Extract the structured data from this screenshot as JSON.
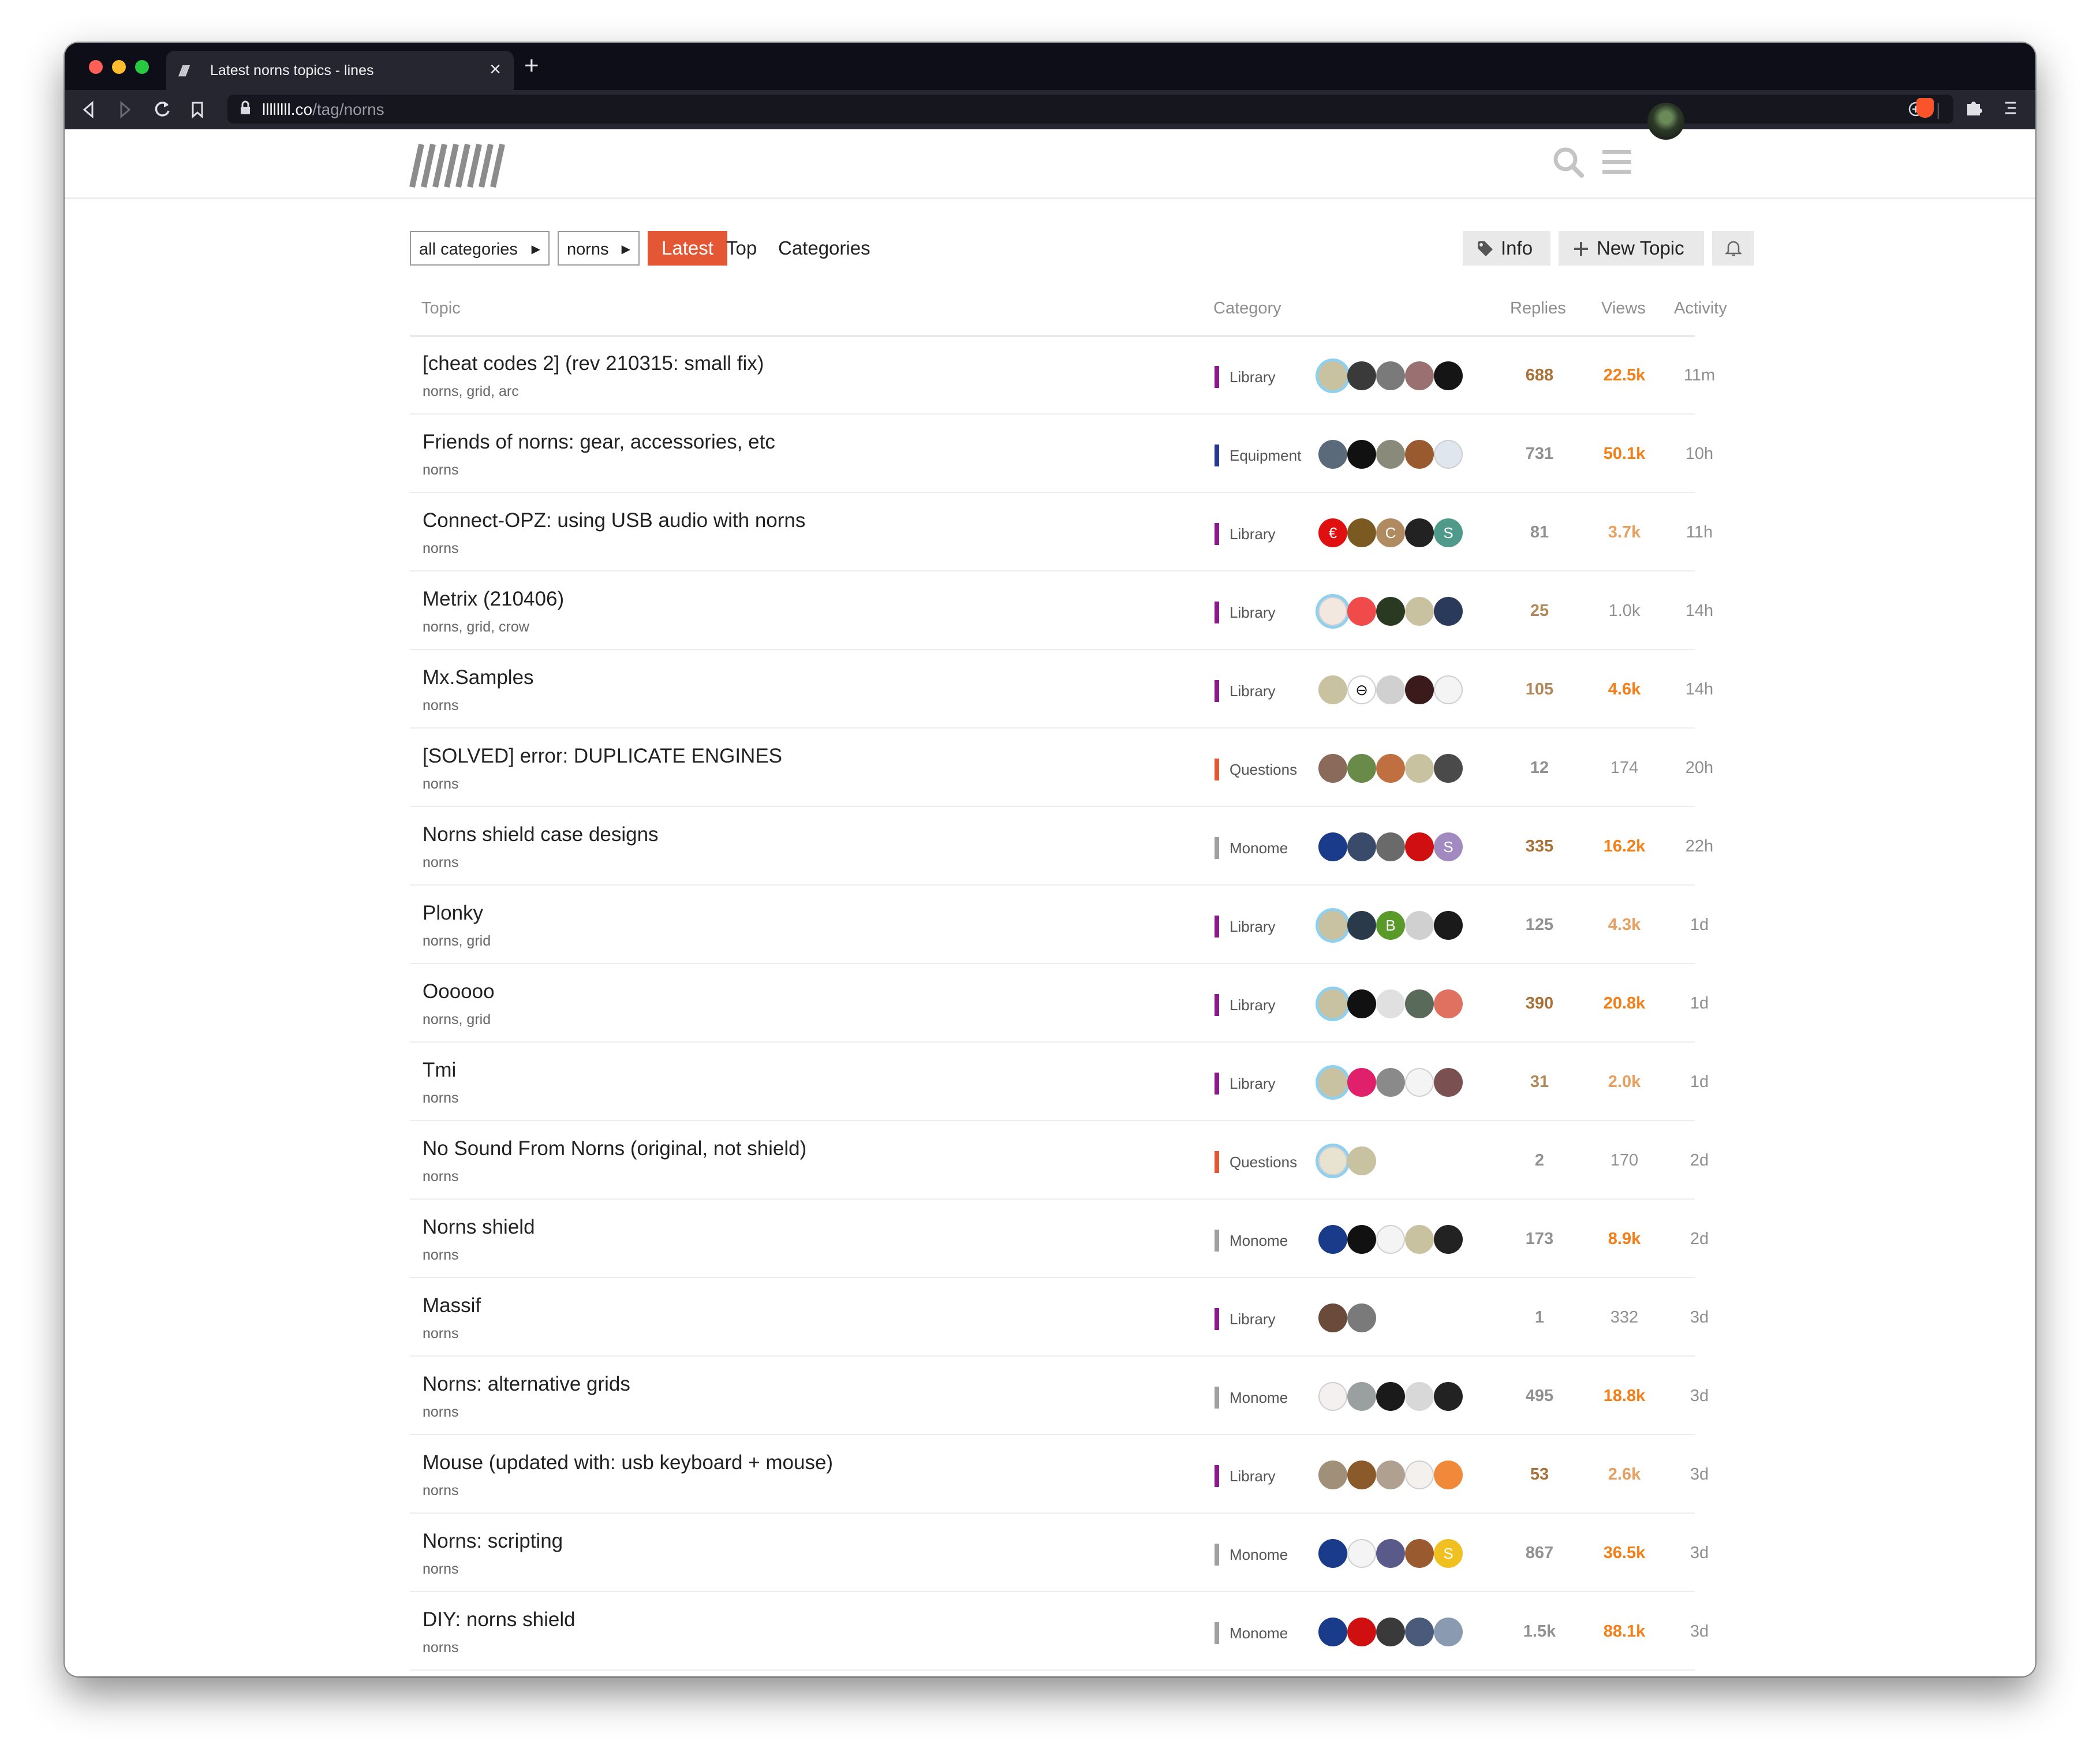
{
  "browser": {
    "tab_title": "Latest norns topics - lines",
    "tab_favicon": "////",
    "tab_close": "×",
    "new_tab": "+",
    "url_domain": "llllllll.co",
    "url_path": "/tag/norns",
    "icons": [
      "back-icon",
      "forward-icon",
      "reload-icon",
      "bookmark-icon",
      "lock-icon",
      "share-icon",
      "brave-shield-icon",
      "extensions-icon",
      "menu-icon"
    ]
  },
  "header": {
    "logo_alt": "llllllll",
    "icons": [
      "search-icon",
      "hamburger-menu-icon",
      "user-avatar"
    ]
  },
  "nav": {
    "category_filter": "all categories",
    "tag_filter": "norns",
    "tabs": [
      "Latest",
      "Top",
      "Categories"
    ],
    "active_tab": "Latest",
    "info_button": "Info",
    "new_topic_button": "New Topic",
    "bell": "notifications-bell-icon"
  },
  "columns": {
    "topic": "Topic",
    "category": "Category",
    "replies": "Replies",
    "views": "Views",
    "activity": "Activity"
  },
  "colors": {
    "accent": "#e45735",
    "Library": "#8c1a8c",
    "Equipment": "#283890",
    "Questions": "#e45735",
    "Monome": "#a0a0a0",
    "replies_hot": "#a87137",
    "views_hot": "#f57f17",
    "neutral": "#919191"
  },
  "topics": [
    {
      "title": "[cheat codes 2] (rev 210315: small fix)",
      "tags": "norns, grid, arc",
      "category": "Library",
      "replies": "688",
      "views": "22.5k",
      "activity": "11m",
      "replies_heat": 2,
      "views_heat": 2,
      "posters": [
        {
          "c": "#c8c2a0",
          "ring": true
        },
        {
          "c": "#3a3a3a"
        },
        {
          "c": "#7a7a7a"
        },
        {
          "c": "#9a7070"
        },
        {
          "c": "#151515"
        }
      ]
    },
    {
      "title": "Friends of norns: gear, accessories, etc",
      "tags": "norns",
      "category": "Equipment",
      "replies": "731",
      "views": "50.1k",
      "activity": "10h",
      "replies_heat": 0,
      "views_heat": 2,
      "posters": [
        {
          "c": "#5a6a7a"
        },
        {
          "c": "#111111"
        },
        {
          "c": "#8a8a7a"
        },
        {
          "c": "#9a5a30"
        },
        {
          "c": "#dfe6ee"
        }
      ]
    },
    {
      "title": "Connect-OPZ: using USB audio with norns",
      "tags": "norns",
      "category": "Library",
      "replies": "81",
      "views": "3.7k",
      "activity": "11h",
      "replies_heat": 0,
      "views_heat": 1,
      "posters": [
        {
          "c": "#e01010",
          "t": "€"
        },
        {
          "c": "#7a5a20"
        },
        {
          "c": "#b08a60",
          "t": "C"
        },
        {
          "c": "#222222"
        },
        {
          "c": "#4f9a8a",
          "t": "S"
        }
      ]
    },
    {
      "title": "Metrix (210406)",
      "tags": "norns, grid, crow",
      "category": "Library",
      "replies": "25",
      "views": "1.0k",
      "activity": "14h",
      "replies_heat": 1,
      "views_heat": 0,
      "posters": [
        {
          "c": "#f2e8e0",
          "ring": true
        },
        {
          "c": "#f04a4a"
        },
        {
          "c": "#2a3a22"
        },
        {
          "c": "#c8c2a0"
        },
        {
          "c": "#2a3a5a"
        }
      ]
    },
    {
      "title": "Mx.Samples",
      "tags": "norns",
      "category": "Library",
      "replies": "105",
      "views": "4.6k",
      "activity": "14h",
      "replies_heat": 1,
      "views_heat": 2,
      "posters": [
        {
          "c": "#c8c2a0"
        },
        {
          "c": "#ffffff",
          "t": "⊖"
        },
        {
          "c": "#d0d0d0"
        },
        {
          "c": "#3a1a1a"
        },
        {
          "c": "#f4f4f4"
        }
      ]
    },
    {
      "title": "[SOLVED] error: DUPLICATE ENGINES",
      "tags": "norns",
      "category": "Questions",
      "replies": "12",
      "views": "174",
      "activity": "20h",
      "replies_heat": 0,
      "views_heat": 0,
      "posters": [
        {
          "c": "#8a6a5a"
        },
        {
          "c": "#6a8a4a"
        },
        {
          "c": "#c07040"
        },
        {
          "c": "#c8c2a0"
        },
        {
          "c": "#4a4a4a"
        }
      ]
    },
    {
      "title": "Norns shield case designs",
      "tags": "norns",
      "category": "Monome",
      "replies": "335",
      "views": "16.2k",
      "activity": "22h",
      "replies_heat": 2,
      "views_heat": 2,
      "posters": [
        {
          "c": "#1a3a8a"
        },
        {
          "c": "#3a4a6a"
        },
        {
          "c": "#6a6a6a"
        },
        {
          "c": "#d01010"
        },
        {
          "c": "#a08ac0",
          "t": "S"
        }
      ]
    },
    {
      "title": "Plonky",
      "tags": "norns, grid",
      "category": "Library",
      "replies": "125",
      "views": "4.3k",
      "activity": "1d",
      "replies_heat": 0,
      "views_heat": 1,
      "posters": [
        {
          "c": "#c8c2a0",
          "ring": true
        },
        {
          "c": "#2a3a4a"
        },
        {
          "c": "#5a9a2a",
          "t": "B"
        },
        {
          "c": "#d0d0d0"
        },
        {
          "c": "#1a1a1a"
        }
      ]
    },
    {
      "title": "Oooooo",
      "tags": "norns, grid",
      "category": "Library",
      "replies": "390",
      "views": "20.8k",
      "activity": "1d",
      "replies_heat": 2,
      "views_heat": 2,
      "posters": [
        {
          "c": "#c8c2a0",
          "ring": true
        },
        {
          "c": "#111111"
        },
        {
          "c": "#e0e0e0"
        },
        {
          "c": "#5a6a5a"
        },
        {
          "c": "#e07060"
        }
      ]
    },
    {
      "title": "Tmi",
      "tags": "norns",
      "category": "Library",
      "replies": "31",
      "views": "2.0k",
      "activity": "1d",
      "replies_heat": 1,
      "views_heat": 1,
      "posters": [
        {
          "c": "#c8c2a0",
          "ring": true
        },
        {
          "c": "#e0206a"
        },
        {
          "c": "#8a8a8a"
        },
        {
          "c": "#f4f4f4"
        },
        {
          "c": "#7a5050"
        }
      ]
    },
    {
      "title": "No Sound From Norns (original, not shield)",
      "tags": "norns",
      "category": "Questions",
      "replies": "2",
      "views": "170",
      "activity": "2d",
      "replies_heat": 0,
      "views_heat": 0,
      "posters": [
        {
          "c": "#e8e2d0",
          "ring": true
        },
        {
          "c": "#c8c2a0"
        }
      ]
    },
    {
      "title": "Norns shield",
      "tags": "norns",
      "category": "Monome",
      "replies": "173",
      "views": "8.9k",
      "activity": "2d",
      "replies_heat": 0,
      "views_heat": 2,
      "posters": [
        {
          "c": "#1a3a8a"
        },
        {
          "c": "#111111"
        },
        {
          "c": "#f4f4f4"
        },
        {
          "c": "#c8c2a0"
        },
        {
          "c": "#222222"
        }
      ]
    },
    {
      "title": "Massif",
      "tags": "norns",
      "category": "Library",
      "replies": "1",
      "views": "332",
      "activity": "3d",
      "replies_heat": 0,
      "views_heat": 0,
      "posters": [
        {
          "c": "#6a4a3a"
        },
        {
          "c": "#7a7a7a"
        }
      ]
    },
    {
      "title": "Norns: alternative grids",
      "tags": "norns",
      "category": "Monome",
      "replies": "495",
      "views": "18.8k",
      "activity": "3d",
      "replies_heat": 0,
      "views_heat": 2,
      "posters": [
        {
          "c": "#f4f0f0"
        },
        {
          "c": "#9aa0a0"
        },
        {
          "c": "#1a1a1a"
        },
        {
          "c": "#d8d8d8"
        },
        {
          "c": "#222222"
        }
      ]
    },
    {
      "title": "Mouse (updated with: usb keyboard + mouse)",
      "tags": "norns",
      "category": "Library",
      "replies": "53",
      "views": "2.6k",
      "activity": "3d",
      "replies_heat": 2,
      "views_heat": 1,
      "posters": [
        {
          "c": "#a0907a"
        },
        {
          "c": "#8a5a2a"
        },
        {
          "c": "#b0a090"
        },
        {
          "c": "#f4f0ee"
        },
        {
          "c": "#f08a3a"
        }
      ]
    },
    {
      "title": "Norns: scripting",
      "tags": "norns",
      "category": "Monome",
      "replies": "867",
      "views": "36.5k",
      "activity": "3d",
      "replies_heat": 0,
      "views_heat": 2,
      "posters": [
        {
          "c": "#1a3a8a"
        },
        {
          "c": "#f4f4f4"
        },
        {
          "c": "#5a5a8a"
        },
        {
          "c": "#9a5a30"
        },
        {
          "c": "#f0c020",
          "t": "S"
        }
      ]
    },
    {
      "title": "DIY: norns shield",
      "tags": "norns",
      "category": "Monome",
      "replies": "1.5k",
      "views": "88.1k",
      "activity": "3d",
      "replies_heat": 0,
      "views_heat": 2,
      "posters": [
        {
          "c": "#1a3a8a"
        },
        {
          "c": "#d01010"
        },
        {
          "c": "#3a3a3a"
        },
        {
          "c": "#4a5a7a"
        },
        {
          "c": "#8a9ab0"
        }
      ]
    }
  ]
}
